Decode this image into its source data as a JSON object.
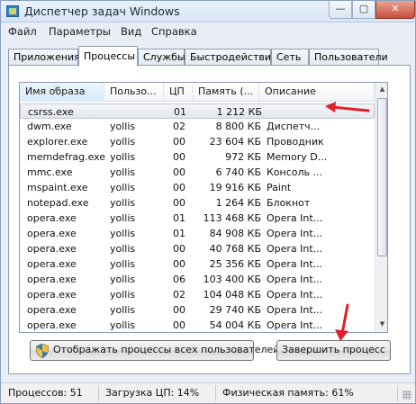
{
  "window": {
    "title": "Диспетчер задач Windows",
    "icon": "task-manager-icon",
    "controls": {
      "minimize": "—",
      "maximize": "▢",
      "close": "✕"
    }
  },
  "menu": [
    "Файл",
    "Параметры",
    "Вид",
    "Справка"
  ],
  "tabs": [
    "Приложения",
    "Процессы",
    "Службы",
    "Быстродействие",
    "Сеть",
    "Пользователи"
  ],
  "active_tab": "Процессы",
  "table": {
    "columns": [
      "Имя образа",
      "Пользо...",
      "ЦП",
      "Память (...",
      "Описание"
    ],
    "sorted_column": "Имя образа",
    "rows": [
      [
        "csrss.exe",
        "",
        "01",
        "1 212 КБ",
        ""
      ],
      [
        "dwm.exe",
        "yollis",
        "02",
        "8 800 КБ",
        "Диспетч..."
      ],
      [
        "explorer.exe",
        "yollis",
        "00",
        "23 604 КБ",
        "Проводник"
      ],
      [
        "memdefrag.exe",
        "yollis",
        "00",
        "972 КБ",
        "Memory D..."
      ],
      [
        "mmc.exe",
        "yollis",
        "00",
        "6 740 КБ",
        "Консоль ..."
      ],
      [
        "mspaint.exe",
        "yollis",
        "00",
        "19 916 КБ",
        "Paint"
      ],
      [
        "notepad.exe",
        "yollis",
        "00",
        "1 264 КБ",
        "Блокнот"
      ],
      [
        "opera.exe",
        "yollis",
        "01",
        "113 468 КБ",
        "Opera Int..."
      ],
      [
        "opera.exe",
        "yollis",
        "01",
        "84 908 КБ",
        "Opera Int..."
      ],
      [
        "opera.exe",
        "yollis",
        "00",
        "40 768 КБ",
        "Opera Int..."
      ],
      [
        "opera.exe",
        "yollis",
        "00",
        "25 356 КБ",
        "Opera Int..."
      ],
      [
        "opera.exe",
        "yollis",
        "06",
        "103 400 КБ",
        "Opera Int..."
      ],
      [
        "opera.exe",
        "yollis",
        "02",
        "104 048 КБ",
        "Opera Int..."
      ],
      [
        "opera.exe",
        "yollis",
        "00",
        "29 740 КБ",
        "Opera Int..."
      ],
      [
        "opera.exe",
        "yollis",
        "00",
        "54 004 КБ",
        "Opera Int..."
      ]
    ],
    "selected_row": 0
  },
  "buttons": {
    "show_all": "Отображать процессы всех пользователей",
    "end_process": "Завершить процесс"
  },
  "status": {
    "processes": "Процессов: 51",
    "cpu": "Загрузка ЦП: 14%",
    "memory": "Физическая память: 61%"
  },
  "colors": {
    "annotation_arrow": "#e0202a",
    "accent": "#3478c6"
  }
}
